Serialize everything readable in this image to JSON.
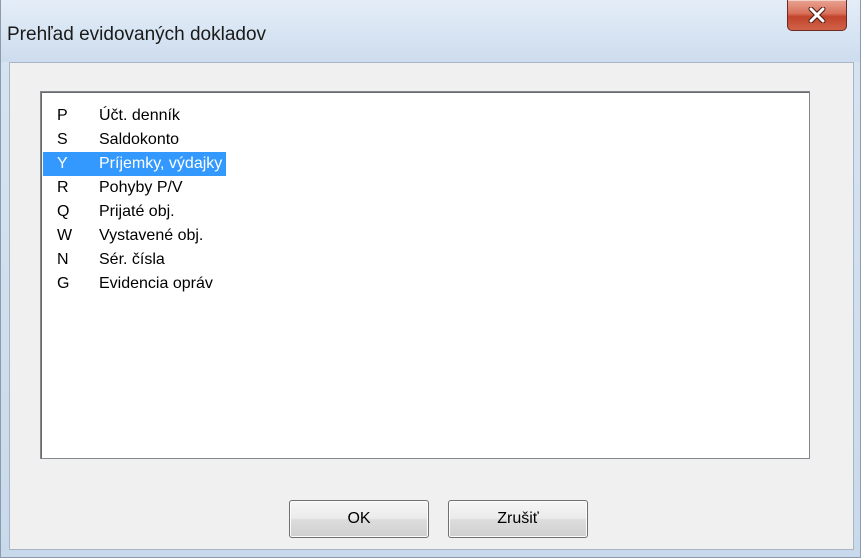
{
  "window": {
    "title": "Prehľad evidovaných dokladov",
    "close_icon": "close-x-icon"
  },
  "list": {
    "items": [
      {
        "code": "P",
        "label": "Účt. denník",
        "selected": false
      },
      {
        "code": "S",
        "label": "Saldokonto",
        "selected": false
      },
      {
        "code": "Y",
        "label": "Príjemky, výdajky",
        "selected": true
      },
      {
        "code": "R",
        "label": "Pohyby P/V",
        "selected": false
      },
      {
        "code": "Q",
        "label": "Prijaté obj.",
        "selected": false
      },
      {
        "code": "W",
        "label": "Vystavené obj.",
        "selected": false
      },
      {
        "code": "N",
        "label": "Sér. čísla",
        "selected": false
      },
      {
        "code": "G",
        "label": "Evidencia opráv",
        "selected": false
      }
    ]
  },
  "buttons": {
    "ok_label": "OK",
    "cancel_label": "Zrušiť"
  },
  "colors": {
    "selection": "#3399ff",
    "close_button": "#c2442c"
  }
}
